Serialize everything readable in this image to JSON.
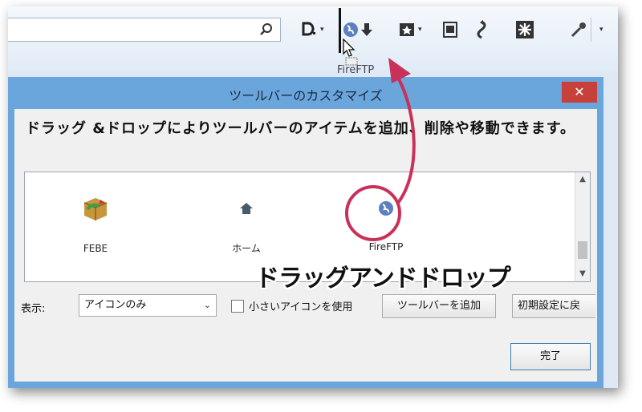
{
  "browser_toolbar": {
    "search": {
      "value": "",
      "placeholder": ""
    },
    "icons": [
      "magnifier-icon",
      "download-icon",
      "firefpt-icon",
      "bookmark-icon",
      "screenshot-icon",
      "sync-icon",
      "addon-icon",
      "eyedropper-icon",
      "menu-chevron-icon"
    ],
    "drop_arrow": "▾",
    "ghost_label": "FireFTP"
  },
  "dialog": {
    "title": "ツールバーのカスタマイズ",
    "close_glyph": "✕",
    "instructions": "ドラッグ &ドロップによりツールバーのアイテムを追加、削除や移動できます。",
    "items": [
      {
        "label": "FEBE",
        "icon": "febe-icon"
      },
      {
        "label": "ホーム",
        "icon": "home-icon"
      },
      {
        "label": "FireFTP",
        "icon": "firefpt-icon"
      }
    ],
    "show_label": "表示:",
    "show_value": "アイコンのみ",
    "small_icons_label": "小さいアイコンを使用",
    "small_icons_checked": false,
    "add_toolbar_label": "ツールバーを追加",
    "restore_defaults_label": "初期設定に戻",
    "done_label": "完了"
  },
  "annotation": {
    "caption": "ドラッグアンドドロップ",
    "color": "#c8325a"
  },
  "colors": {
    "dialog_frame": "#6aa6dc",
    "close_button": "#c7413a",
    "toolbar_bg": "#e1ebf6"
  }
}
